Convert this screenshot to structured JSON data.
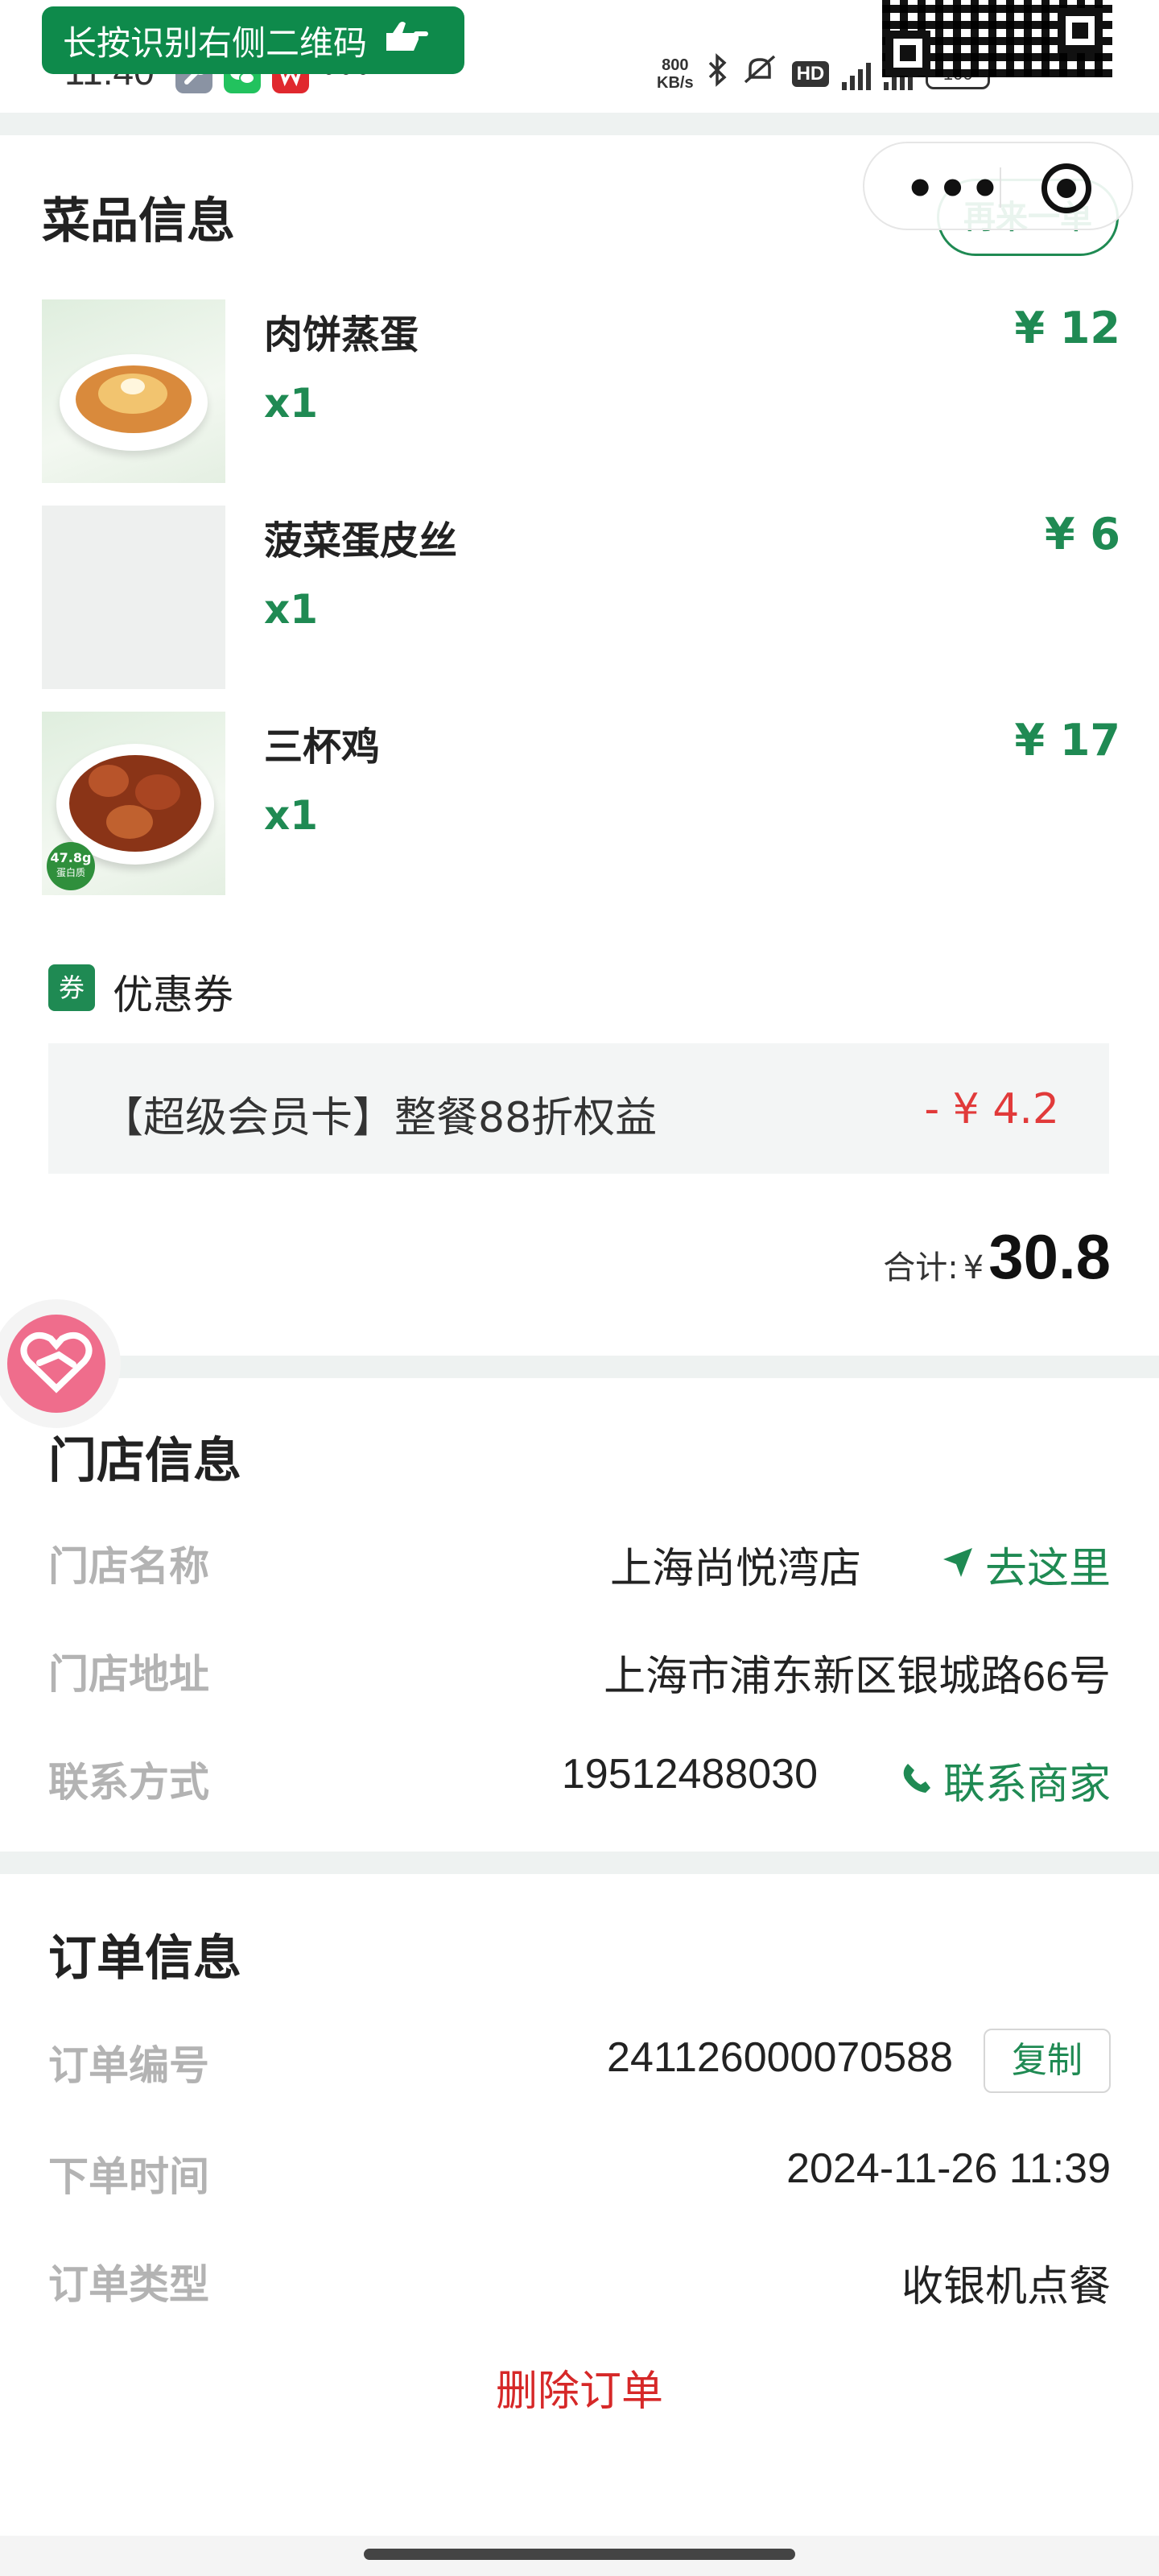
{
  "status_bar": {
    "time": "11:40",
    "net_speed_value": "800",
    "net_speed_unit": "KB/s",
    "battery": "100",
    "icons": [
      "wrench-app-icon",
      "wechat-app-icon",
      "wps-app-icon",
      "more-dots-icon",
      "bluetooth-icon",
      "mute-icon",
      "hd-badge-icon",
      "signal-icon",
      "battery-icon"
    ]
  },
  "qr_banner": {
    "text": "长按识别右侧二维码"
  },
  "capsule": {
    "more": "•••"
  },
  "reorder_label": "再来一单",
  "dish_section": {
    "title": "菜品信息",
    "items": [
      {
        "name": "肉饼蒸蛋",
        "qty": "x1",
        "price": "¥ 12"
      },
      {
        "name": "菠菜蛋皮丝",
        "qty": "x1",
        "price": "¥ 6"
      },
      {
        "name": "三杯鸡",
        "qty": "x1",
        "price": "¥ 17"
      }
    ],
    "badge_3_main": "47.8g",
    "badge_3_sub": "蛋白质"
  },
  "coupon": {
    "tag": "券",
    "label": "优惠券",
    "name": "【超级会员卡】整餐88折权益",
    "discount": "- ¥ 4.2"
  },
  "total": {
    "label": "合计:",
    "currency": "¥",
    "value": "30.8"
  },
  "store": {
    "title": "门店信息",
    "name_label": "门店名称",
    "name_value": "上海尚悦湾店",
    "navigate_label": "去这里",
    "address_label": "门店地址",
    "address_value": "上海市浦东新区银城路66号",
    "contact_label": "联系方式",
    "contact_value": "19512488030",
    "contact_action": "联系商家"
  },
  "order": {
    "title": "订单信息",
    "number_label": "订单编号",
    "number_value": "241126000070588",
    "copy_label": "复制",
    "time_label": "下单时间",
    "time_value": "2024-11-26 11:39",
    "type_label": "订单类型",
    "type_value": "收银机点餐",
    "delete_label": "删除订单"
  },
  "colors": {
    "accent_green": "#1f8a53",
    "banner_green": "#0e8a4b",
    "discount_red": "#e13a3a",
    "delete_red": "#d62828",
    "muted_label": "#b3b3b3"
  }
}
